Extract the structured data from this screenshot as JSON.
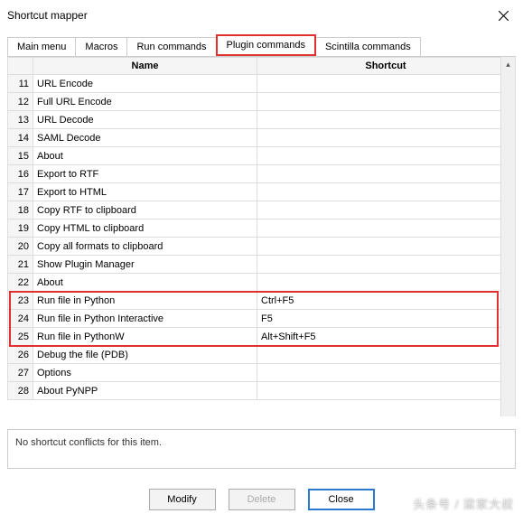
{
  "window": {
    "title": "Shortcut mapper"
  },
  "tabs": [
    {
      "label": "Main menu"
    },
    {
      "label": "Macros"
    },
    {
      "label": "Run commands"
    },
    {
      "label": "Plugin commands",
      "active": true,
      "highlight": true
    },
    {
      "label": "Scintilla commands"
    }
  ],
  "columns": {
    "name": "Name",
    "shortcut": "Shortcut"
  },
  "rows": [
    {
      "n": 11,
      "name": "URL Encode",
      "shortcut": ""
    },
    {
      "n": 12,
      "name": "Full URL Encode",
      "shortcut": ""
    },
    {
      "n": 13,
      "name": "URL Decode",
      "shortcut": ""
    },
    {
      "n": 14,
      "name": "SAML Decode",
      "shortcut": ""
    },
    {
      "n": 15,
      "name": "About",
      "shortcut": ""
    },
    {
      "n": 16,
      "name": "Export to RTF",
      "shortcut": ""
    },
    {
      "n": 17,
      "name": "Export to HTML",
      "shortcut": ""
    },
    {
      "n": 18,
      "name": "Copy RTF to clipboard",
      "shortcut": ""
    },
    {
      "n": 19,
      "name": "Copy HTML to clipboard",
      "shortcut": ""
    },
    {
      "n": 20,
      "name": "Copy all formats to clipboard",
      "shortcut": ""
    },
    {
      "n": 21,
      "name": "Show Plugin Manager",
      "shortcut": ""
    },
    {
      "n": 22,
      "name": "About",
      "shortcut": ""
    },
    {
      "n": 23,
      "name": "Run file in Python",
      "shortcut": "Ctrl+F5",
      "hl": true
    },
    {
      "n": 24,
      "name": "Run file in Python Interactive",
      "shortcut": "F5",
      "hl": true
    },
    {
      "n": 25,
      "name": "Run file in PythonW",
      "shortcut": "Alt+Shift+F5",
      "hl": true
    },
    {
      "n": 26,
      "name": "Debug the file (PDB)",
      "shortcut": ""
    },
    {
      "n": 27,
      "name": "Options",
      "shortcut": ""
    },
    {
      "n": 28,
      "name": "About PyNPP",
      "shortcut": ""
    }
  ],
  "status": "No shortcut conflicts for this item.",
  "buttons": {
    "modify": "Modify",
    "delete": "Delete",
    "close": "Close"
  },
  "watermark": "头条号 / 梁家大叔"
}
